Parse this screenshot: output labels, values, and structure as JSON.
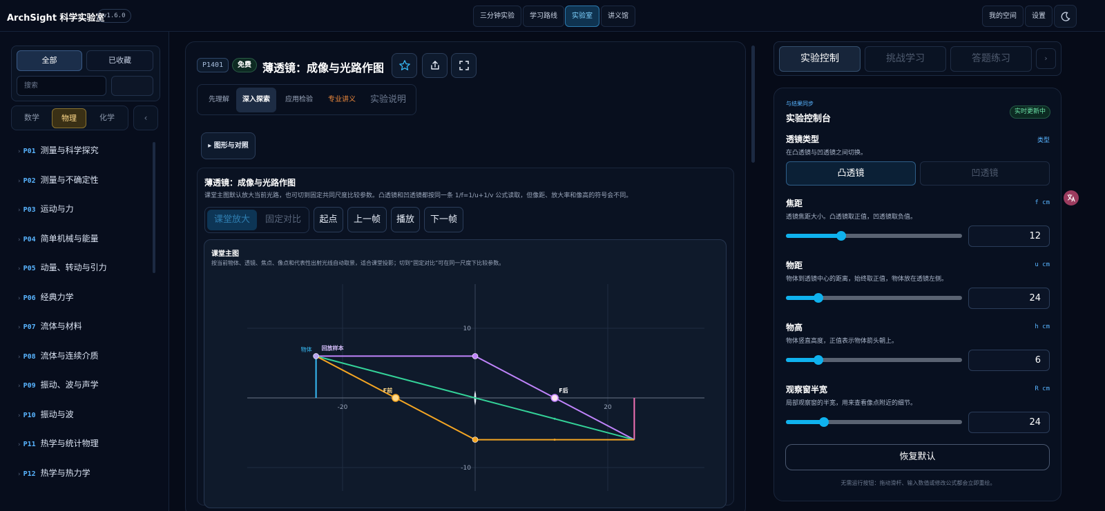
{
  "header": {
    "brand": "ArchSight 科学实验室",
    "version": "v1.6.0",
    "nav": [
      "三分钟实验",
      "学习路线",
      "实验室",
      "讲义馆"
    ],
    "nav_active": "实验室",
    "space": "我的空间",
    "settings": "设置",
    "theme_icon": "moon-icon"
  },
  "sidebar": {
    "filters": [
      "全部",
      "已收藏"
    ],
    "filter_active": "全部",
    "search_placeholder": "搜索",
    "subjects": [
      "数学",
      "物理",
      "化学"
    ],
    "subject_active": "物理",
    "collapse_icon": "‹",
    "lessons": [
      {
        "code": "P01",
        "name": "测量与科学探究"
      },
      {
        "code": "P02",
        "name": "测量与不确定性"
      },
      {
        "code": "P03",
        "name": "运动与力"
      },
      {
        "code": "P04",
        "name": "简单机械与能量"
      },
      {
        "code": "P05",
        "name": "动量、转动与引力"
      },
      {
        "code": "P06",
        "name": "经典力学"
      },
      {
        "code": "P07",
        "name": "流体与材料"
      },
      {
        "code": "P08",
        "name": "流体与连续介质"
      },
      {
        "code": "P09",
        "name": "振动、波与声学"
      },
      {
        "code": "P10",
        "name": "振动与波"
      },
      {
        "code": "P11",
        "name": "热学与统计物理"
      },
      {
        "code": "P12",
        "name": "热学与热力学"
      }
    ]
  },
  "main": {
    "code": "P1401",
    "badge": "免费",
    "title": "薄透镜：成像与光路作图",
    "tool_icons": [
      "star-icon",
      "share-icon",
      "fullscreen-icon"
    ],
    "tabs": [
      "先理解",
      "深入探索",
      "应用检验",
      "专业讲义",
      "实验说明"
    ],
    "tab_active": "深入探索",
    "accent_tab_color": "#f08a3c",
    "toggle": "▸ 图形与对照",
    "card_title": "薄透镜：成像与光路作图",
    "card_desc": "课堂主图默认放大当前光路，也可切到固定共同尺度比较参数。凸透镜和凹透镜都按同一条 1/f=1/u+1/v 公式读取，但像距、放大率和像高的符号会不同。",
    "view_modes": [
      "课堂放大",
      "固定对比"
    ],
    "view_active": "课堂放大",
    "controls": [
      "起点",
      "上一帧",
      "播放",
      "下一帧"
    ],
    "stage_title": "课堂主图",
    "stage_desc": "按当前物体、透镜、焦点、像点和代表性出射光线自动取景，适合课堂投影；切到“固定对比”可在同一尺度下比较参数。"
  },
  "chart_data": {
    "type": "ray-diagram",
    "xlim": [
      -24,
      24
    ],
    "ylim": [
      -12,
      12
    ],
    "ticks_x": [
      -20,
      20
    ],
    "ticks_y": [
      10,
      -10
    ],
    "labels": {
      "object": "物体",
      "sample": "回放样本",
      "f_front": "F前",
      "f_back": "F后"
    },
    "object": {
      "x": -24,
      "height": 6
    },
    "lens_x": 0,
    "focal": 12,
    "image": {
      "x": 24,
      "height": -6
    },
    "colors": {
      "parallel_ray": "#c084fc",
      "center_ray": "#34d399",
      "focal_ray": "#f5a623",
      "object": "#38bdf8",
      "image": "#f472b6"
    }
  },
  "panel": {
    "tabs": [
      "实验控制",
      "挑战学习",
      "答题练习"
    ],
    "tab_active": "实验控制",
    "next_icon": "›",
    "sync": "与结果同步",
    "title": "实验控制台",
    "live": "实时更新中",
    "lens_type": {
      "label": "透镜类型",
      "tag": "类型",
      "desc": "在凸透镜与凹透镜之间切换。",
      "options": [
        "凸透镜",
        "凹透镜"
      ],
      "active": "凸透镜"
    },
    "params": [
      {
        "label": "焦距",
        "unit": "f cm",
        "desc": "透镜焦距大小。凸透镜取正值，凹透镜取负值。",
        "value": "12",
        "fraction": 0.315
      },
      {
        "label": "物距",
        "unit": "u cm",
        "desc": "物体到透镜中心的距离，始终取正值，物体放在透镜左侧。",
        "value": "24",
        "fraction": 0.185
      },
      {
        "label": "物高",
        "unit": "h cm",
        "desc": "物体竖直高度，正值表示物体箭头朝上。",
        "value": "6",
        "fraction": 0.185
      },
      {
        "label": "观察窗半宽",
        "unit": "R cm",
        "desc": "局部观察窗的半宽，用来查看像点附近的细节。",
        "value": "24",
        "fraction": 0.215
      }
    ],
    "reset": "恢复默认",
    "footer": "无需运行按钮：拖动滑杆、输入数值或修改公式都会立即重绘。"
  }
}
